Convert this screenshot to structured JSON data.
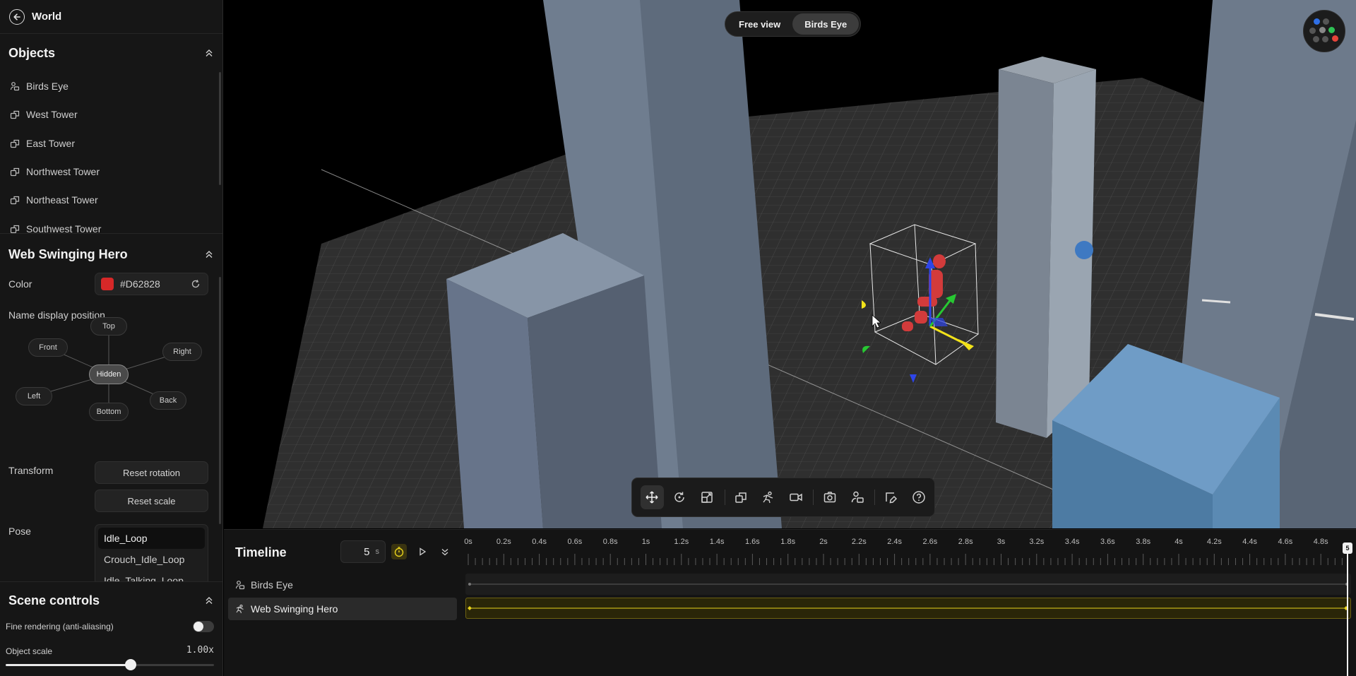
{
  "header": {
    "back_title": "World"
  },
  "objects": {
    "title": "Objects",
    "items": [
      {
        "label": "Birds Eye",
        "icon": "camera-person-icon"
      },
      {
        "label": "West Tower",
        "icon": "shapes-icon"
      },
      {
        "label": "East Tower",
        "icon": "shapes-icon"
      },
      {
        "label": "Northwest Tower",
        "icon": "shapes-icon"
      },
      {
        "label": "Northeast Tower",
        "icon": "shapes-icon"
      },
      {
        "label": "Southwest Tower",
        "icon": "shapes-icon"
      }
    ]
  },
  "selected_object": {
    "title": "Web Swinging Hero",
    "color_label": "Color",
    "color_value": "#D62828",
    "name_display_label": "Name display position",
    "positions": {
      "top": "Top",
      "front": "Front",
      "right": "Right",
      "hidden": "Hidden",
      "left": "Left",
      "back": "Back",
      "bottom": "Bottom"
    },
    "active_position": "Hidden",
    "transform_label": "Transform",
    "reset_rotation": "Reset rotation",
    "reset_scale": "Reset scale",
    "pose_label": "Pose",
    "poses": [
      "Idle_Loop",
      "Crouch_Idle_Loop",
      "Idle_Talking_Loop"
    ],
    "selected_pose": "Idle_Loop"
  },
  "scene_controls": {
    "title": "Scene controls",
    "fine_rendering_label": "Fine rendering (anti-aliasing)",
    "fine_rendering_on": false,
    "object_scale_label": "Object scale",
    "object_scale_value": "1.00x",
    "object_scale_fraction": 0.6
  },
  "viewport": {
    "view_options": [
      "Free view",
      "Birds Eye"
    ],
    "active_view": "Birds Eye",
    "tools": [
      "move-icon",
      "rotate-icon",
      "scale-icon",
      "shapes-icon",
      "pose-icon",
      "video-camera-icon",
      "screenshot-icon",
      "camera-person-icon",
      "path-edit-icon",
      "help-icon"
    ],
    "active_tool": "move-icon",
    "colors": {
      "hero": "#D62828",
      "gizmo_x": "#F2E21A",
      "gizmo_y": "#2E45E8",
      "gizmo_z": "#27C832"
    }
  },
  "timeline": {
    "title": "Timeline",
    "duration": "5",
    "duration_unit": "s",
    "ruler_labels": [
      "0s",
      "0.2s",
      "0.4s",
      "0.6s",
      "0.8s",
      "1s",
      "1.2s",
      "1.4s",
      "1.6s",
      "1.8s",
      "2s",
      "2.2s",
      "2.4s",
      "2.6s",
      "2.8s",
      "3s",
      "3.2s",
      "3.4s",
      "3.6s",
      "3.8s",
      "4s",
      "4.2s",
      "4.4s",
      "4.6s",
      "4.8s"
    ],
    "playhead_label": "5",
    "tracks": [
      {
        "label": "Birds Eye",
        "icon": "camera-person-icon"
      },
      {
        "label": "Web Swinging Hero",
        "icon": "pose-icon"
      }
    ],
    "selected_track": "Web Swinging Hero",
    "accent": "#E8D21C"
  }
}
